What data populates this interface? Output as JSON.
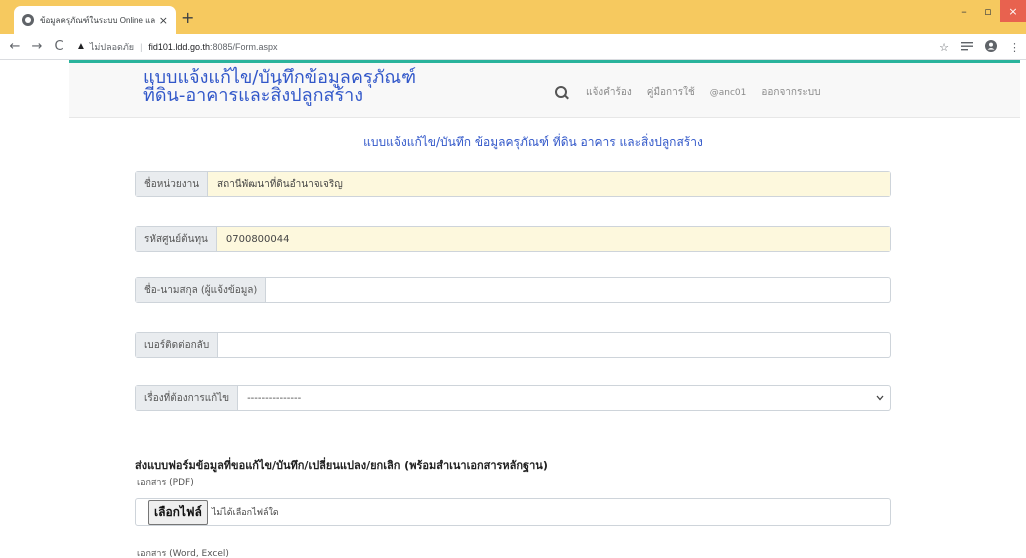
{
  "browser": {
    "tab_title": "ข้อมูลครุภัณฑ์ในระบบ Online และสิ่งปลู",
    "tab_close": "×",
    "new_tab": "+",
    "security_label": "ไม่ปลอดภัย",
    "url_host": "fid101.ldd.go.th",
    "url_path": ":8085/Form.aspx",
    "back": "←",
    "forward": "→",
    "reload": "C",
    "warn": "▲",
    "separator": "|",
    "win_min": "–",
    "win_max": "▫",
    "win_close": "×",
    "star": "☆",
    "menu": "⋮"
  },
  "header": {
    "brand_line1": "แบบแจ้งแก้ไข/บันทึกข้อมูลครุภัณฑ์",
    "brand_line2": "ที่ดิน-อาคารและสิ่งปลูกสร้าง",
    "nav": [
      {
        "label": "แจ้งคำร้อง"
      },
      {
        "label": "คู่มือการใช้"
      },
      {
        "label": "@anc01"
      },
      {
        "label": "ออกจากระบบ"
      }
    ]
  },
  "form": {
    "title": "แบบแจ้งแก้ไข/บันทึก ข้อมูลครุภัณฑ์ ที่ดิน อาคาร และสิ่งปลูกสร้าง",
    "fields": {
      "agency_label": "ชื่อหน่วยงาน",
      "agency_value": "สถานีพัฒนาที่ดินอำนาจเจริญ",
      "cost_center_label": "รหัสศูนย์ต้นทุน",
      "cost_center_value": "0700800044",
      "reporter_label": "ชื่อ-นามสกุล (ผู้แจ้งข้อมูล)",
      "reporter_value": "",
      "phone_label": "เบอร์ติดต่อกลับ",
      "phone_value": "",
      "subject_label": "เรื่องที่ต้องการแก้ไข",
      "subject_value": "---------------"
    },
    "attach_heading": "ส่งแบบฟอร์มข้อมูลที่ขอแก้ไข/บันทึก/เปลี่ยนแปลง/ยกเลิก (พร้อมสำเนาเอกสารหลักฐาน)",
    "pdf_label": "เอกสาร (PDF)",
    "choose_file": "เลือกไฟล์",
    "no_file": "ไม่ได้เลือกไฟล์ใด",
    "word_label": "เอกสาร (Word, Excel)"
  }
}
